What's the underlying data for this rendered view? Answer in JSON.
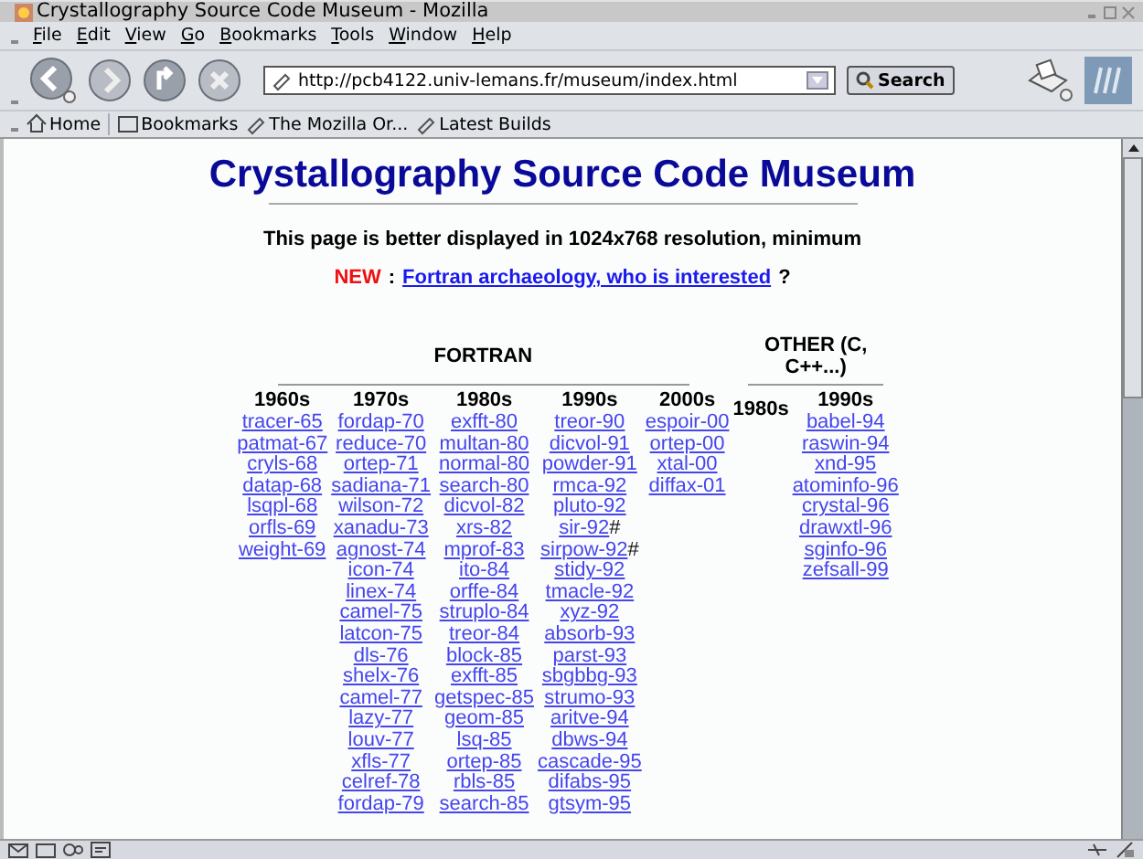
{
  "window": {
    "title": "Crystallography Source Code Museum - Mozilla"
  },
  "menu": [
    "File",
    "Edit",
    "View",
    "Go",
    "Bookmarks",
    "Tools",
    "Window",
    "Help"
  ],
  "navigation": {
    "url": "http://pcb4122.univ-lemans.fr/museum/index.html",
    "search_button": "Search"
  },
  "bookmarks_bar": [
    "Home",
    "Bookmarks",
    "The Mozilla Or...",
    "Latest Builds"
  ],
  "page": {
    "title": "Crystallography Source Code Museum",
    "notice": "This page is better displayed in 1024x768 resolution, minimum",
    "news": {
      "label": "NEW",
      "separator": ":",
      "link": "Fortran archaeology, who is interested",
      "suffix": "?"
    },
    "sections": [
      {
        "title": "FORTRAN",
        "decades": [
          {
            "heading": "1960s",
            "programs": [
              {
                "name": "tracer-65"
              },
              {
                "name": "patmat-67"
              },
              {
                "name": "cryls-68"
              },
              {
                "name": "datap-68"
              },
              {
                "name": "lsqpl-68"
              },
              {
                "name": "orfls-69"
              },
              {
                "name": "weight-69"
              }
            ]
          },
          {
            "heading": "1970s",
            "programs": [
              {
                "name": "fordap-70"
              },
              {
                "name": "reduce-70"
              },
              {
                "name": "ortep-71"
              },
              {
                "name": "sadiana-71"
              },
              {
                "name": "wilson-72"
              },
              {
                "name": "xanadu-73"
              },
              {
                "name": "agnost-74"
              },
              {
                "name": "icon-74"
              },
              {
                "name": "linex-74"
              },
              {
                "name": "camel-75"
              },
              {
                "name": "latcon-75"
              },
              {
                "name": "dls-76"
              },
              {
                "name": "shelx-76"
              },
              {
                "name": "camel-77"
              },
              {
                "name": "lazy-77"
              },
              {
                "name": "louv-77"
              },
              {
                "name": "xfls-77"
              },
              {
                "name": "celref-78"
              },
              {
                "name": "fordap-79"
              }
            ]
          },
          {
            "heading": "1980s",
            "programs": [
              {
                "name": "exfft-80"
              },
              {
                "name": "multan-80"
              },
              {
                "name": "normal-80"
              },
              {
                "name": "search-80"
              },
              {
                "name": "dicvol-82"
              },
              {
                "name": "xrs-82"
              },
              {
                "name": "mprof-83"
              },
              {
                "name": "ito-84"
              },
              {
                "name": "orffe-84"
              },
              {
                "name": "struplo-84"
              },
              {
                "name": "treor-84"
              },
              {
                "name": "block-85"
              },
              {
                "name": "exfft-85"
              },
              {
                "name": "getspec-85"
              },
              {
                "name": "geom-85"
              },
              {
                "name": "lsq-85"
              },
              {
                "name": "ortep-85"
              },
              {
                "name": "rbls-85"
              },
              {
                "name": "search-85"
              }
            ]
          },
          {
            "heading": "1990s",
            "programs": [
              {
                "name": "treor-90"
              },
              {
                "name": "dicvol-91"
              },
              {
                "name": "powder-91"
              },
              {
                "name": "rmca-92"
              },
              {
                "name": "pluto-92"
              },
              {
                "name": "sir-92",
                "suffix": "#"
              },
              {
                "name": "sirpow-92",
                "suffix": "#"
              },
              {
                "name": "stidy-92"
              },
              {
                "name": "tmacle-92"
              },
              {
                "name": "xyz-92"
              },
              {
                "name": "absorb-93"
              },
              {
                "name": "parst-93"
              },
              {
                "name": "sbgbbg-93"
              },
              {
                "name": "strumo-93"
              },
              {
                "name": "aritve-94"
              },
              {
                "name": "dbws-94"
              },
              {
                "name": "cascade-95"
              },
              {
                "name": "difabs-95"
              },
              {
                "name": "gtsym-95"
              }
            ]
          },
          {
            "heading": "2000s",
            "programs": [
              {
                "name": "espoir-00"
              },
              {
                "name": "ortep-00"
              },
              {
                "name": "xtal-00"
              },
              {
                "name": "diffax-01"
              }
            ]
          }
        ]
      },
      {
        "title": "OTHER (C, C++...)",
        "decades": [
          {
            "heading": "1980s"
          },
          {
            "heading": "1990s",
            "programs": [
              {
                "name": "babel-94"
              },
              {
                "name": "raswin-94"
              },
              {
                "name": "xnd-95"
              },
              {
                "name": "atominfo-96"
              },
              {
                "name": "crystal-96"
              },
              {
                "name": "drawxtl-96"
              },
              {
                "name": "sginfo-96"
              },
              {
                "name": "zefsall-99"
              }
            ]
          }
        ]
      }
    ]
  }
}
